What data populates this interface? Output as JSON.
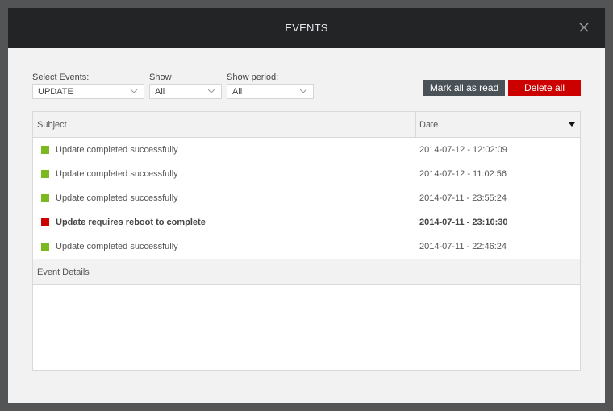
{
  "dialog": {
    "title": "EVENTS",
    "close_icon": "close-icon"
  },
  "filters": {
    "select_events": {
      "label": "Select Events:",
      "value": "UPDATE"
    },
    "show": {
      "label": "Show",
      "value": "All"
    },
    "show_period": {
      "label": "Show period:",
      "value": "All"
    }
  },
  "actions": {
    "mark_all_read": "Mark all as read",
    "delete_all": "Delete all"
  },
  "colors": {
    "success": "#7cb820",
    "error": "#cc0000",
    "mark_button": "#4a5258",
    "delete_button": "#cc0000"
  },
  "table": {
    "columns": {
      "subject": "Subject",
      "date": "Date"
    },
    "sort": "descending",
    "rows": [
      {
        "status": "success",
        "subject": "Update completed successfully",
        "date": "2014-07-12 - 12:02:09",
        "unread": false
      },
      {
        "status": "success",
        "subject": "Update completed successfully",
        "date": "2014-07-12 - 11:02:56",
        "unread": false
      },
      {
        "status": "success",
        "subject": "Update completed successfully",
        "date": "2014-07-11 - 23:55:24",
        "unread": false
      },
      {
        "status": "error",
        "subject": "Update requires reboot to complete",
        "date": "2014-07-11 - 23:10:30",
        "unread": true
      },
      {
        "status": "success",
        "subject": "Update completed successfully",
        "date": "2014-07-11 - 22:46:24",
        "unread": false
      }
    ]
  },
  "details": {
    "heading": "Event Details",
    "content": ""
  }
}
